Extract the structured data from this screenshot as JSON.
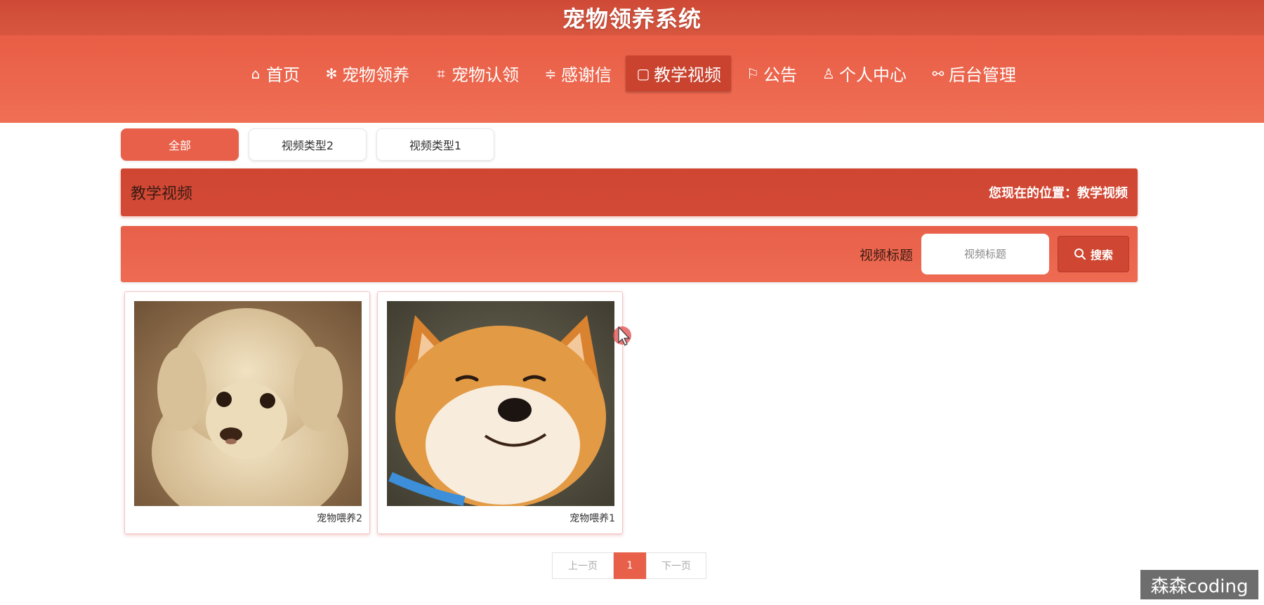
{
  "app": {
    "title": "宠物领养系统"
  },
  "nav": {
    "items": [
      {
        "icon": "home-icon",
        "glyph": "⌂",
        "label": "首页"
      },
      {
        "icon": "snowflake-icon",
        "glyph": "✻",
        "label": "宠物领养"
      },
      {
        "icon": "tag-icon",
        "glyph": "⌗",
        "label": "宠物认领"
      },
      {
        "icon": "sliders-icon",
        "glyph": "≑",
        "label": "感谢信"
      },
      {
        "icon": "square-icon",
        "glyph": "▢",
        "label": "教学视频"
      },
      {
        "icon": "flag-icon",
        "glyph": "⚐",
        "label": "公告"
      },
      {
        "icon": "user-icon",
        "glyph": "♙",
        "label": "个人中心"
      },
      {
        "icon": "link-icon",
        "glyph": "⚯",
        "label": "后台管理"
      }
    ],
    "active_index": 4
  },
  "category_tabs": [
    {
      "label": "全部",
      "active": true
    },
    {
      "label": "视频类型2",
      "active": false
    },
    {
      "label": "视频类型1",
      "active": false
    }
  ],
  "section": {
    "title": "教学视频",
    "breadcrumb": "您现在的位置：教学视频"
  },
  "search": {
    "label": "视频标题",
    "placeholder": "视频标题",
    "value": "",
    "button_label": "搜索",
    "button_icon": "search-icon"
  },
  "videos": [
    {
      "title": "宠物喂养2",
      "image": "puppy-photo"
    },
    {
      "title": "宠物喂养1",
      "image": "shiba-photo"
    }
  ],
  "pagination": {
    "prev_label": "上一页",
    "current_page": "1",
    "next_label": "下一页"
  },
  "watermark": "森森coding",
  "colors": {
    "primary": "#e8604a",
    "primary_dark": "#cf4632",
    "title_bar": "#d14e38"
  }
}
